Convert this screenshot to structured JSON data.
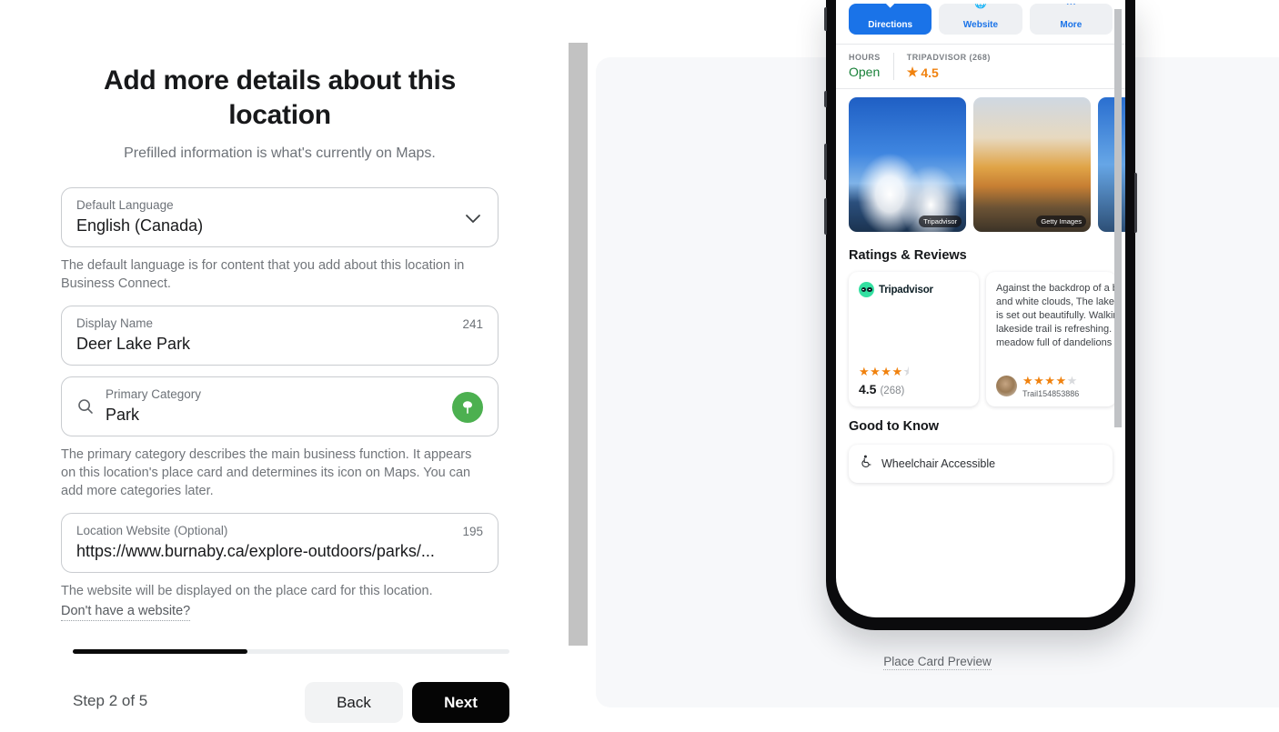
{
  "form": {
    "title": "Add more details about this location",
    "subtitle": "Prefilled information is what's currently on Maps.",
    "fields": {
      "language": {
        "label": "Default Language",
        "value": "English (Canada)",
        "helper": "The default language is for content that you add about this location in Business Connect.",
        "chevron_icon": "chevron-down-icon"
      },
      "display_name": {
        "label": "Display Name",
        "value": "Deer Lake Park",
        "counter": "241"
      },
      "primary_category": {
        "label": "Primary Category",
        "value": "Park",
        "search_icon": "search-icon",
        "badge_icon": "tree-icon",
        "badge_color": "#4CB050",
        "helper": "The primary category describes the main business function. It appears on this location's place card and determines its icon on Maps. You can add more categories later."
      },
      "website": {
        "label": "Location Website (Optional)",
        "value": "https://www.burnaby.ca/explore-outdoors/parks/...",
        "counter": "195",
        "helper": "The website will be displayed on the place card for this location.",
        "link": "Don't have a website?"
      }
    },
    "footer": {
      "step_text": "Step 2 of 5",
      "progress_percent": 40,
      "back_label": "Back",
      "next_label": "Next"
    }
  },
  "preview": {
    "caption": "Place Card Preview",
    "actions": [
      {
        "label": "Directions",
        "icon": "directions-icon",
        "primary": true
      },
      {
        "label": "Website",
        "icon": "globe-icon",
        "primary": false
      },
      {
        "label": "More",
        "icon": "more-icon",
        "primary": false
      }
    ],
    "meta": [
      {
        "key": "HOURS",
        "value": "Open"
      },
      {
        "key": "TRIPADVISOR (268)",
        "value": "4.5",
        "star_icon": "star-icon"
      }
    ],
    "photos": [
      {
        "credit": "Tripadvisor"
      },
      {
        "credit": "Getty Images"
      },
      {
        "credit": ""
      }
    ],
    "ratings_section_title": "Ratings & Reviews",
    "tripadvisor_card": {
      "brand": "Tripadvisor",
      "stars": "★★★★",
      "half_star": "⯨",
      "score": "4.5",
      "count": "(268)"
    },
    "review_card": {
      "text": "Against the backdrop of a blue sky and white clouds, The lake surface is set out beautifully. Walking on the lakeside trail is refreshing. The meadow full of dandelions feels like",
      "stars_filled": "★★★★",
      "stars_empty": "★",
      "user": "Trail154853886"
    },
    "good_to_know_title": "Good to Know",
    "good_to_know_items": [
      {
        "label": "Wheelchair Accessible",
        "icon": "wheelchair-icon"
      }
    ]
  }
}
